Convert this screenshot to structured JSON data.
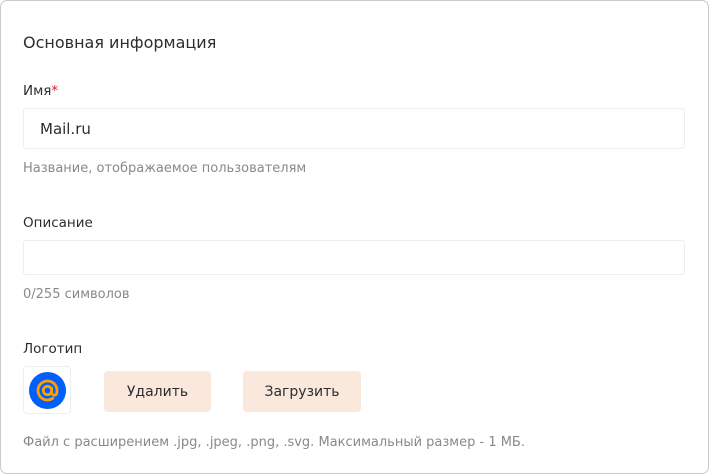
{
  "section": {
    "title": "Основная информация"
  },
  "name_field": {
    "label": "Имя",
    "required_mark": "*",
    "value": "Mail.ru",
    "hint": "Название, отображаемое пользователям"
  },
  "description_field": {
    "label": "Описание",
    "value": "",
    "counter": "0/255 символов"
  },
  "logo_field": {
    "label": "Логотип",
    "icon": "mailru-at-logo",
    "delete_label": "Удалить",
    "upload_label": "Загрузить",
    "hint": "Файл с расширением .jpg, .jpeg, .png, .svg. Максимальный размер - 1 МБ."
  },
  "colors": {
    "logo_blue": "#005ff9",
    "logo_orange": "#ff9e00",
    "button_bg": "#fae8dc",
    "required": "#ed0a34"
  }
}
